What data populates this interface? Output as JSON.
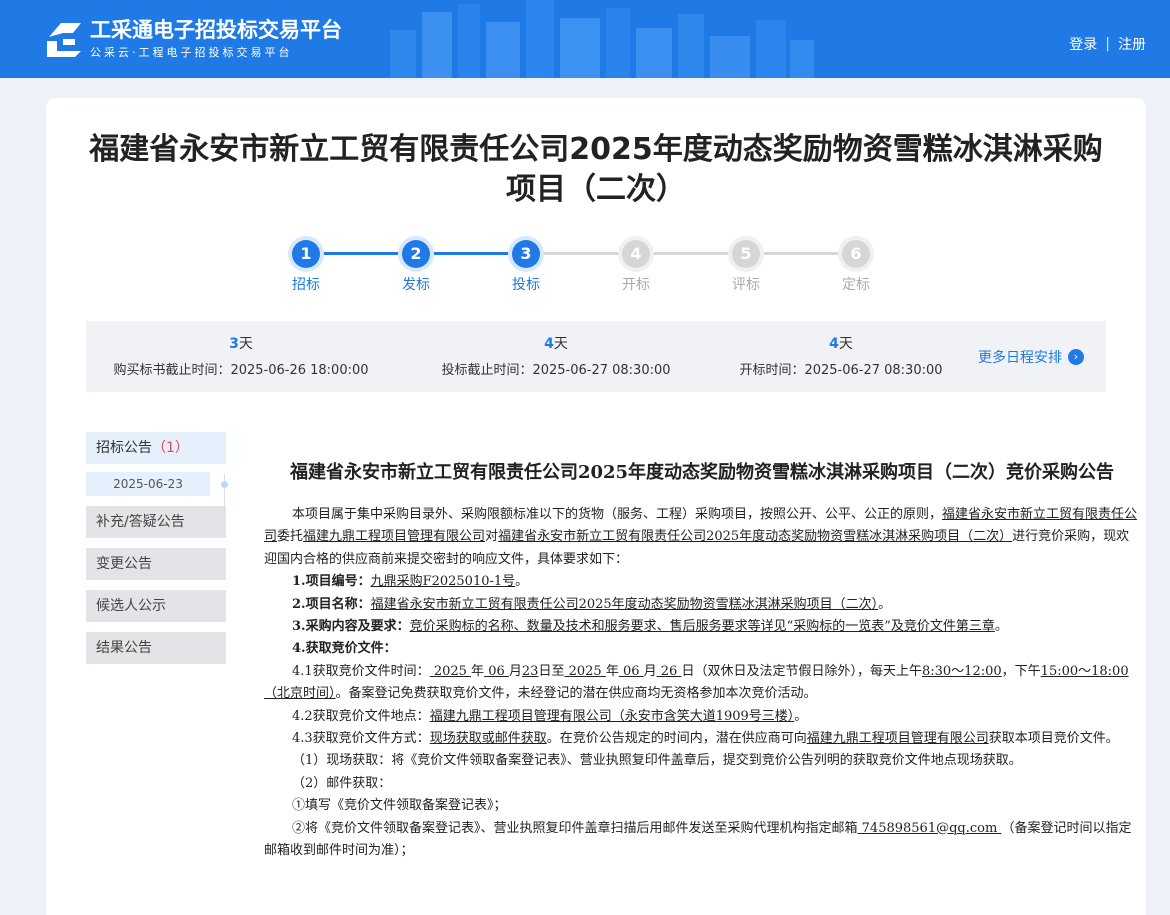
{
  "header": {
    "brand_title": "工采通电子招投标交易平台",
    "brand_sub": "公采云·工程电子招投标交易平台",
    "login": "登录",
    "separator": "|",
    "register": "注册",
    "color": "#1f7ae6"
  },
  "page": {
    "title": "福建省永安市新立工贸有限责任公司2025年度动态奖励物资雪糕冰淇淋采购项目（二次）"
  },
  "steps": [
    {
      "num": "1",
      "label": "招标",
      "done": true
    },
    {
      "num": "2",
      "label": "发标",
      "done": true
    },
    {
      "num": "3",
      "label": "投标",
      "done": true
    },
    {
      "num": "4",
      "label": "开标",
      "done": false
    },
    {
      "num": "5",
      "label": "评标",
      "done": false
    },
    {
      "num": "6",
      "label": "定标",
      "done": false
    }
  ],
  "schedule": [
    {
      "days": "3",
      "unit": "天",
      "text": "购买标书截止时间：2025-06-26 18:00:00"
    },
    {
      "days": "4",
      "unit": "天",
      "text": "投标截止时间：2025-06-27 08:30:00"
    },
    {
      "days": "4",
      "unit": "天",
      "text": "开标时间：2025-06-27 08:30:00"
    }
  ],
  "more_schedule": "更多日程安排",
  "sidebar": {
    "active_label": "招标公告",
    "active_count": "（1）",
    "date": "2025-06-23",
    "items": [
      "补充/答疑公告",
      "变更公告",
      "候选人公示",
      "结果公告"
    ]
  },
  "notice": {
    "title": "福建省永安市新立工贸有限责任公司2025年度动态奖励物资雪糕冰淇淋采购项目（二次）竞价采购公告",
    "intro_a": "本项目属于集中采购目录外、采购限额标准以下的货物（服务、工程）采购项目，按照公开、公平、公正的原则，",
    "intro_b": "福建省永安市新立工贸有限责任公司",
    "intro_c": "委托",
    "intro_d": "福建九鼎工程项目管理有限公司",
    "intro_e": "对",
    "intro_f": "福建省永安市新立工贸有限责任公司2025年度动态奖励物资雪糕冰淇淋采购项目（二次）",
    "intro_g": "进行竞价采购，现欢迎国内合格的供应商前来提交密封的响应文件，具体要求如下：",
    "l1_label": "1.项目编号：",
    "l1_value": "九鼎采购F2025010-1号",
    "l1_end": "。",
    "l2_label": "2.项目名称：",
    "l2_value": "福建省永安市新立工贸有限责任公司2025年度动态奖励物资雪糕冰淇淋采购项目（二次）",
    "l2_end": "。",
    "l3_label": "3.采购内容及要求：",
    "l3_value": "竞价采购标的名称、数量及技术和服务要求、售后服务要求等详见“采购标的一览表”及竞价文件第三章",
    "l3_end": "。",
    "l4_label": "4.获取竞价文件：",
    "l41_a": "4.1获取竞价文件时间：",
    "l41_y1": " 2025 ",
    "l41_nian1": "年",
    "l41_m1": " 06 ",
    "l41_yue1": "月",
    "l41_d1": "23",
    "l41_ri1": "日至",
    "l41_y2": " 2025 ",
    "l41_nian2": "年",
    "l41_m2": " 06 ",
    "l41_yue2": "月",
    "l41_d2": " 26 ",
    "l41_ri2": "日（双休日及法定节假日除外），每天上午",
    "l41_am": "8:30～12:00",
    "l41_mid": "，下午",
    "l41_pm": "15:00～18:00（北京时间）",
    "l41_end": "。备案登记免费获取竞价文件，未经登记的潜在供应商均无资格参加本次竞价活动。",
    "l42_a": "4.2获取竞价文件地点：",
    "l42_value": "福建九鼎工程项目管理有限公司（永安市含笑大道1909号三楼）",
    "l42_end": "。",
    "l43_a": "4.3获取竞价文件方式：",
    "l43_value": "现场获取或邮件获取",
    "l43_b": "。在竞价公告规定的时间内，潜在供应商可向",
    "l43_org": "福建九鼎工程项目管理有限公司",
    "l43_c": "获取本项目竞价文件。",
    "p1": "（1）现场获取：将《竞价文件领取备案登记表》、营业执照复印件盖章后，提交到竞价公告列明的获取竞价文件地点现场获取。",
    "p2": "（2）邮件获取：",
    "p3": "①填写《竞价文件领取备案登记表》；",
    "p4_a": "②将《竞价文件领取备案登记表》、营业执照复印件盖章扫描后用邮件发送至采购代理机构指定邮箱",
    "p4_email": " 745898561@qq.com ",
    "p4_b": "（备案登记时间以指定邮箱收到邮件时间为准）；"
  }
}
